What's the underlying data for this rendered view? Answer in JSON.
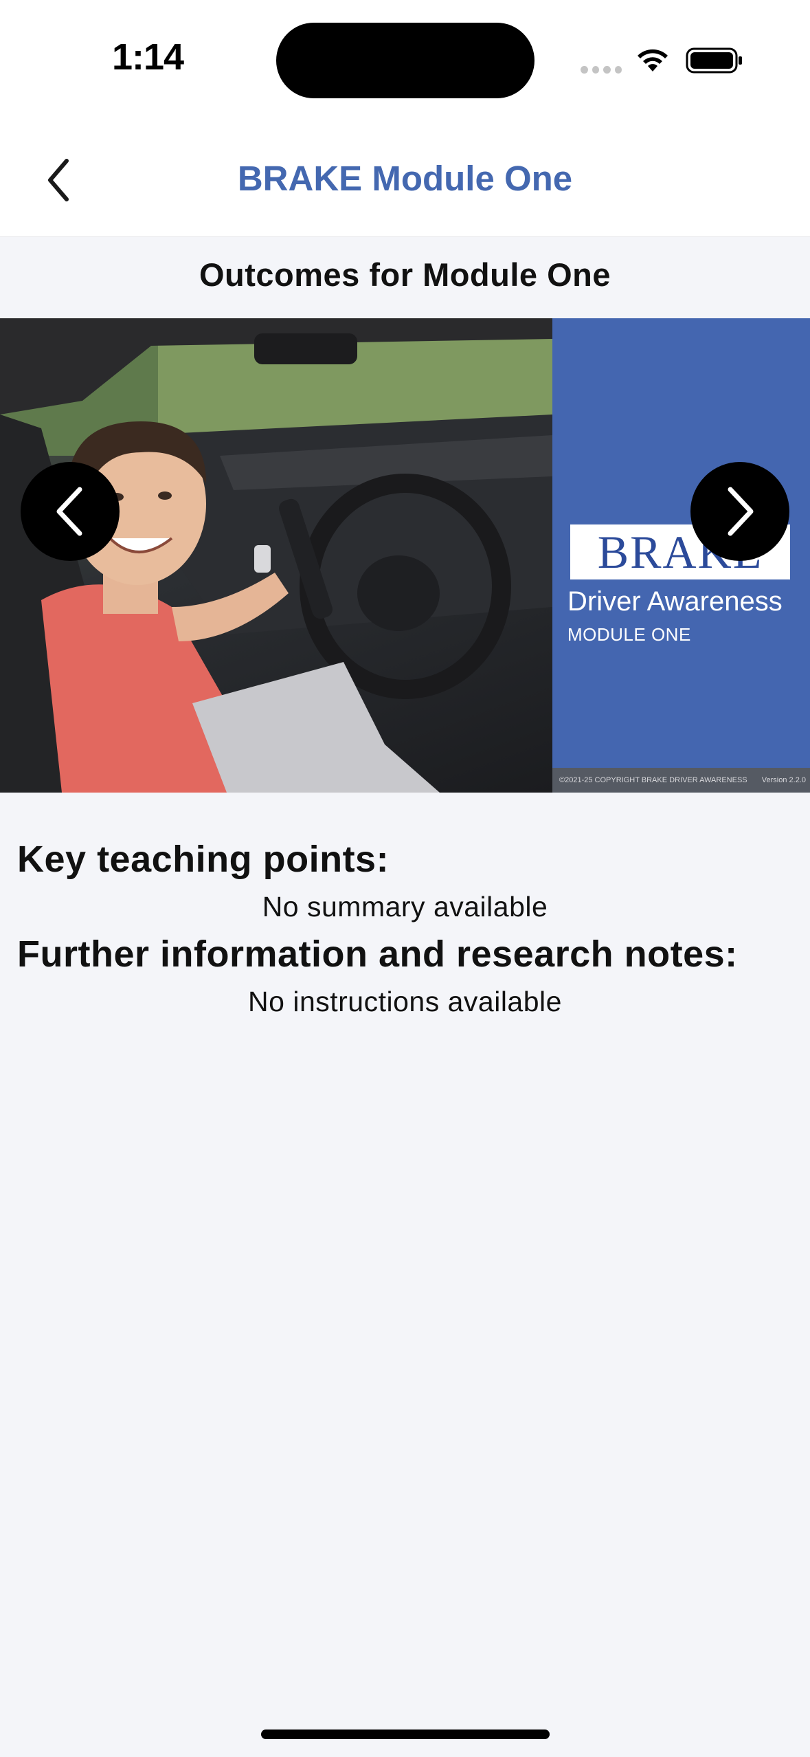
{
  "status_bar": {
    "time": "1:14",
    "icons": [
      "signal-dots-icon",
      "wifi-icon",
      "battery-icon"
    ]
  },
  "nav": {
    "back_icon": "chevron-left-icon",
    "title": "BRAKE Module One",
    "title_color": "#4468b0"
  },
  "section": {
    "title": "Outcomes for Module One"
  },
  "carousel": {
    "prev_icon": "chevron-left-icon",
    "next_icon": "chevron-right-icon",
    "cover": {
      "logo_text": "BRAKE",
      "heading": "Driver Awareness",
      "subheading": "MODULE ONE",
      "copyright": "©2021-25 COPYRIGHT BRAKE DRIVER AWARENESS",
      "version": "Version 2.2.0",
      "background_color": "#4466b0"
    }
  },
  "content": {
    "key_points_heading": "Key teaching points:",
    "key_points_text": "No summary available",
    "further_info_heading": "Further information and research notes:",
    "further_info_text": "No instructions available"
  }
}
